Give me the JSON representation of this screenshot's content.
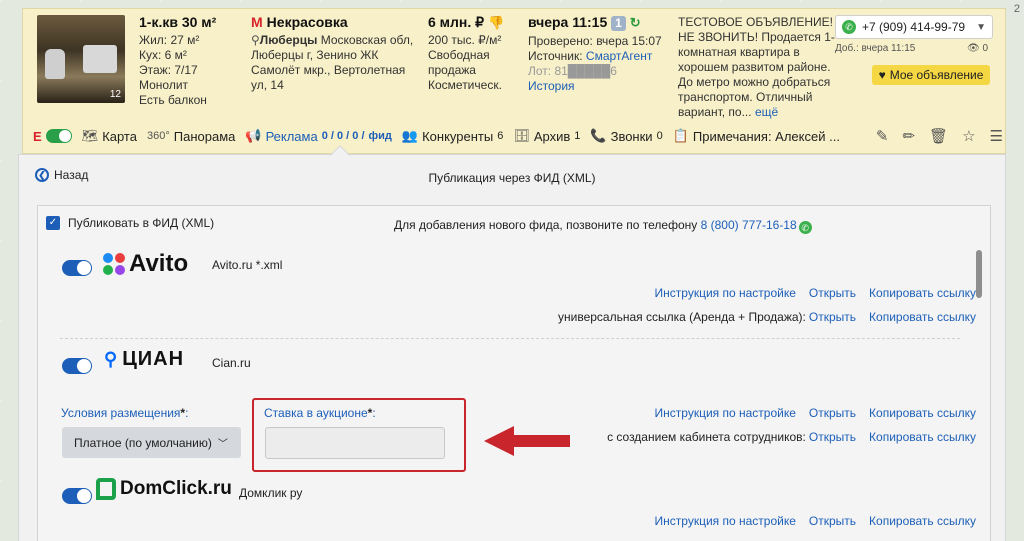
{
  "page_number": "2",
  "listing": {
    "photo_count": "12",
    "title": "1-к.кв 30 м²",
    "details": [
      "Жил: 27 м²",
      "Кух: 6 м²",
      "Этаж: 7/17",
      "Монолит",
      "Есть балкон"
    ],
    "metro": "Некрасовка",
    "address_city": "Люберцы",
    "address_rest": "Московская обл, Люберцы г, Зенино ЖК Самолёт мкр., Вертолетная ул, 14",
    "price": "6 млн. ₽",
    "price_per_m": "200 тыс. ₽/м²",
    "sale_type": "Свободная продажа",
    "finish": "Косметическ.",
    "date": "вчера 11:15",
    "date_count": "1",
    "checked": "Проверено: вчера 15:07",
    "source_label": "Источник:",
    "source_value": "СмартАгент",
    "lot": "Лот: 81█████6",
    "history": "История",
    "description": "ТЕСТОВОЕ ОБЪЯВЛЕНИЕ! НЕ ЗВОНИТЬ! Продается 1-комнатная квартира в хорошем развитом районе. До метро можно добраться транспортом. Отличный вариант, по...",
    "more": "ещё",
    "phone": "+7 (909) 414-99-79",
    "added": "Доб.: вчера 11:15",
    "views": "0",
    "my_ad": "Мое объявление"
  },
  "toolbar": {
    "map": "Карта",
    "panorama_badge": "360°",
    "panorama": "Панорама",
    "reklama": "Реклама",
    "reklama_counts": "0 / 0 / 0 /",
    "feed": "фид",
    "competitors": "Конкуренты",
    "competitors_count": "6",
    "archive": "Архив",
    "archive_count": "1",
    "calls": "Звонки",
    "calls_count": "0",
    "notes": "Примечания: Алексей ..."
  },
  "panel": {
    "back": "Назад",
    "title": "Публикация через ФИД (XML)",
    "publish_checkbox": "Публиковать в ФИД (XML)",
    "hint": "Для добавления нового фида, позвоните по телефону",
    "hint_phone": "8 (800) 777-16-18"
  },
  "feeds": {
    "avito": {
      "logo": "Avito",
      "desc": "Avito.ru *.xml",
      "row1": [
        "Инструкция по настройке",
        "Открыть",
        "Копировать ссылку"
      ],
      "row2_label": "универсальная ссылка (Аренда + Продажа):",
      "row2": [
        "Открыть",
        "Копировать ссылку"
      ]
    },
    "cian": {
      "logo": "ЦИАН",
      "desc": "Cian.ru",
      "conditions_label": "Условия размещения",
      "conditions_value": "Платное (по умолчанию)",
      "bid_label": "Ставка в аукционе",
      "bid_value": "",
      "row1": [
        "Инструкция по настройке",
        "Открыть",
        "Копировать ссылку"
      ],
      "row2_label": "с созданием кабинета сотрудников:",
      "row2": [
        "Открыть",
        "Копировать ссылку"
      ]
    },
    "domclick": {
      "logo": "DomClick.ru",
      "desc": "Домклик ру",
      "row1": [
        "Инструкция по настройке",
        "Открыть",
        "Копировать ссылку"
      ]
    }
  },
  "colors": {
    "card_bg": "#f7f0c8",
    "link": "#1d5fb8",
    "highlight": "#c8252c",
    "toggle_green": "#2a9f4a"
  }
}
